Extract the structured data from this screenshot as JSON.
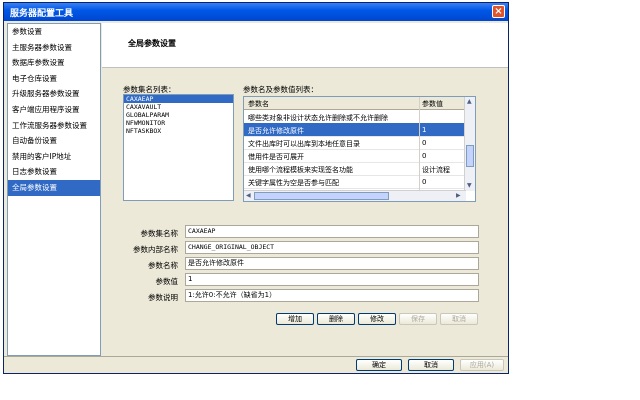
{
  "window": {
    "title": "服务器配置工具"
  },
  "sidebar": {
    "items": [
      {
        "label": "参数设置"
      },
      {
        "label": "主服务器参数设置"
      },
      {
        "label": "数据库参数设置"
      },
      {
        "label": "电子仓库设置"
      },
      {
        "label": "升级服务器参数设置"
      },
      {
        "label": "客户端应用程序设置"
      },
      {
        "label": "工作流服务器参数设置"
      },
      {
        "label": "自动备份设置"
      },
      {
        "label": "禁用的客户IP地址"
      },
      {
        "label": "日志参数设置"
      },
      {
        "label": "全局参数设置"
      }
    ],
    "active_index": 10
  },
  "main": {
    "page_title": "全局参数设置",
    "param_set_list_label": "参数集名列表：",
    "param_set_list": [
      "CAXAEAP",
      "CAXAVAULT",
      "GLOBALPARAM",
      "NFWMONITOR",
      "NFTASKBOX"
    ],
    "selected_param_set": 0,
    "param_grid_label": "参数名及参数值列表：",
    "grid": {
      "col_name": "参数名",
      "col_value": "参数值",
      "rows": [
        {
          "name": "哪些类对象非设计状态允许删除或不允许删除",
          "value": ""
        },
        {
          "name": "是否允许修改原件",
          "value": "1"
        },
        {
          "name": "文件出库时可以出库到本地任意目录",
          "value": "0"
        },
        {
          "name": "借用件是否可展开",
          "value": "0"
        },
        {
          "name": "使用哪个流程模板来实现签名功能",
          "value": "设计流程"
        },
        {
          "name": "关键字属性为空是否参与匹配",
          "value": "0"
        }
      ],
      "selected_row": 1
    },
    "fields": {
      "set_name_label": "参数集名称",
      "set_name_value": "CAXAEAP",
      "internal_name_label": "参数内部名称",
      "internal_name_value": "CHANGE_ORIGINAL_OBJECT",
      "param_name_label": "参数名称",
      "param_name_value": "是否允许修改原件",
      "param_value_label": "参数值",
      "param_value_value": "1",
      "param_desc_label": "参数说明",
      "param_desc_value": "1:允许0:不允许（缺省为1）"
    },
    "buttons": {
      "add": "增加",
      "delete": "删除",
      "modify": "修改",
      "save": "保存",
      "cancel": "取消"
    }
  },
  "footer": {
    "ok": "确定",
    "cancel": "取消",
    "apply": "应用(A)"
  }
}
